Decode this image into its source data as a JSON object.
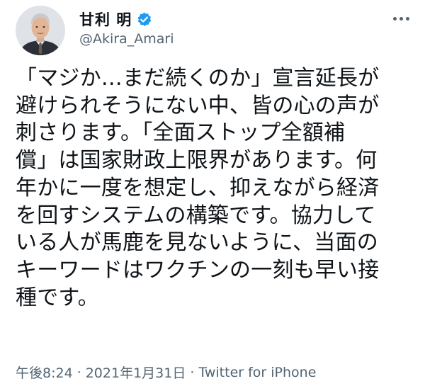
{
  "author": {
    "display_name": "甘利 明",
    "handle": "@Akira_Amari",
    "verified": true,
    "verified_icon": "verified-badge-icon",
    "avatar_icon": "profile-photo"
  },
  "more_icon": "more-horizontal-icon",
  "tweet": {
    "lines": [
      "「マジか…まだ続くのか」宣言延長が",
      "避けられそうにない中、皆の心の声が",
      "刺さります。「全面ストップ全額補",
      "償」は国家財政上限界があります。何",
      "年かに一度を想定し、抑えながら経済",
      "を回すシステムの構築です。協力して",
      "いる人が馬鹿を見ないように、当面の",
      "キーワードはワクチンの一刻も早い接",
      "種です。"
    ]
  },
  "meta": {
    "time": "午後8:24",
    "separator": "·",
    "date": "2021年1月31日",
    "source": "Twitter for iPhone"
  },
  "colors": {
    "text_primary": "#0f1419",
    "text_secondary": "#536471",
    "verified_blue": "#1d9bf0",
    "background": "#ffffff"
  }
}
